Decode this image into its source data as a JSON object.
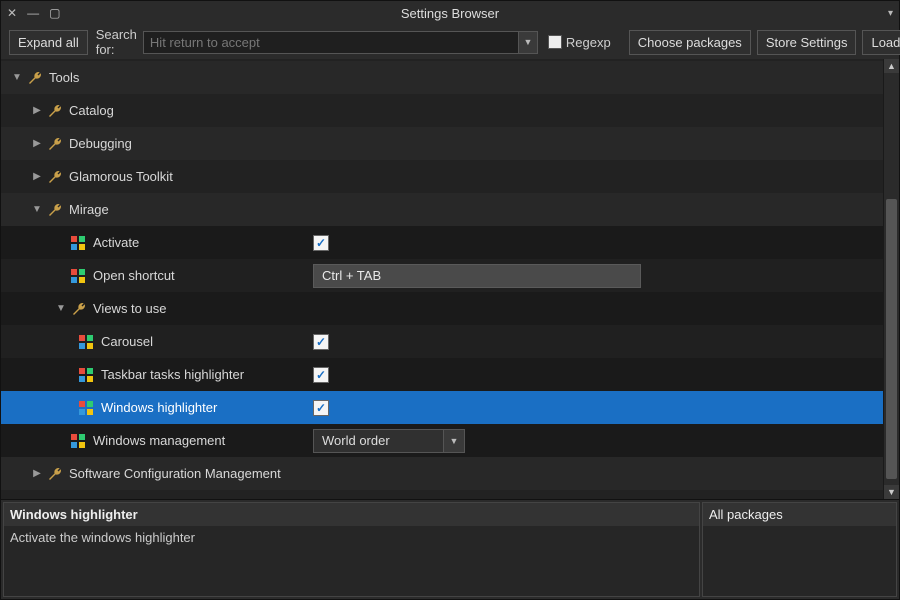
{
  "window": {
    "title": "Settings Browser"
  },
  "toolbar": {
    "expand_all": "Expand all",
    "search_label": "Search for:",
    "search_placeholder": "Hit return to accept",
    "regexp_label": "Regexp",
    "regexp_checked": false,
    "choose_packages": "Choose packages",
    "store_settings": "Store Settings",
    "load_settings": "Load Settings"
  },
  "tree": {
    "root": {
      "label": "Tools",
      "expanded": true
    },
    "children": [
      {
        "label": "Catalog",
        "expanded": false
      },
      {
        "label": "Debugging",
        "expanded": false
      },
      {
        "label": "Glamorous Toolkit",
        "expanded": false
      },
      {
        "label": "Mirage",
        "expanded": true
      },
      {
        "label": "Software Configuration Management",
        "expanded": false
      }
    ],
    "mirage": {
      "activate": {
        "label": "Activate",
        "checked": true
      },
      "open_shortcut": {
        "label": "Open shortcut",
        "value": "Ctrl + TAB"
      },
      "views": {
        "label": "Views to use",
        "expanded": true
      },
      "carousel": {
        "label": "Carousel",
        "checked": true
      },
      "taskbar": {
        "label": "Taskbar tasks highlighter",
        "checked": true
      },
      "windows_highlighter": {
        "label": "Windows highlighter",
        "checked": true,
        "selected": true
      },
      "windows_management": {
        "label": "Windows management",
        "value": "World order"
      }
    }
  },
  "details": {
    "title": "Windows highlighter",
    "description": "Activate the windows highlighter",
    "side": "All packages"
  }
}
